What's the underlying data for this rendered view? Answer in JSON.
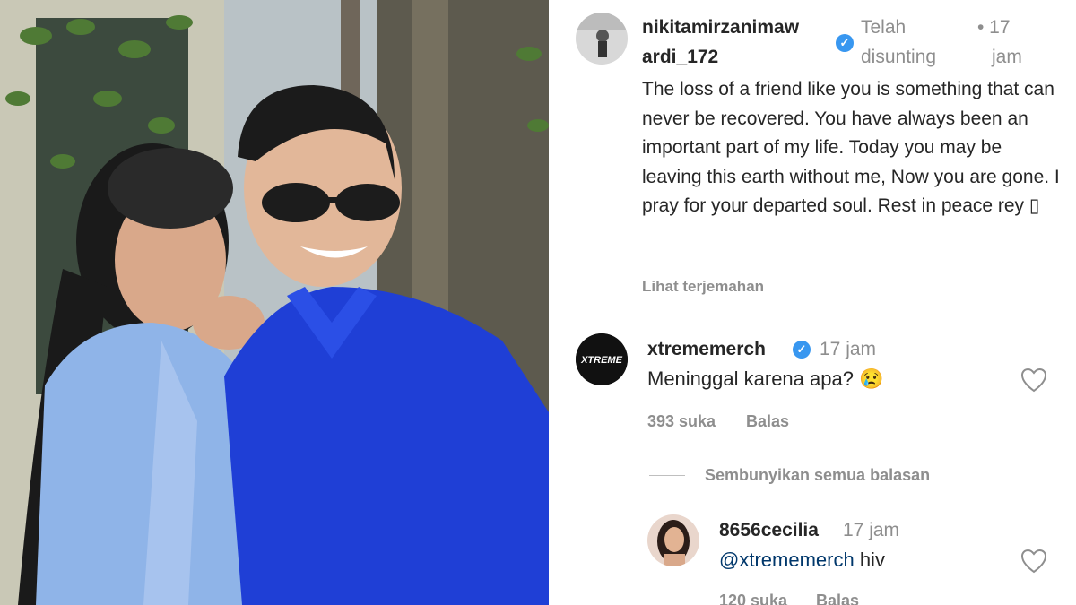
{
  "post": {
    "author": "nikitamirzanimawardi_172",
    "author_line1": "nikitamirzanimaw",
    "author_line2": "ardi_172",
    "edited_line1": "Telah",
    "edited_line2": "disunting",
    "time_line1": "• 17",
    "time_line2": "jam",
    "caption": "The loss of a friend like you is something that can never be recovered. You have always been an important part of my life. Today you may be leaving this earth without me, Now you are gone. I pray for your departed soul. Rest in peace rey ▯",
    "translate_label": "Lihat terjemahan"
  },
  "comments": [
    {
      "username": "xtrememerch",
      "avatar_text": "XTREME",
      "verified": true,
      "time": "17 jam",
      "text": "Meninggal karena apa? 😢",
      "likes": "393 suka",
      "reply_label": "Balas"
    }
  ],
  "thread": {
    "hide_replies_label": "Sembunyikan semua balasan"
  },
  "replies": [
    {
      "username": "8656cecilia",
      "time": "17 jam",
      "mention": "@xtrememerch",
      "text": " hiv",
      "likes": "120 suka",
      "reply_label": "Balas"
    }
  ],
  "icons": {
    "verified": "verified-badge-icon",
    "like": "heart-icon"
  },
  "colors": {
    "verified_blue": "#3897f0",
    "secondary_text": "#8e8e8e",
    "primary_text": "#262626",
    "mention": "#00376b",
    "shirt_blue": "#1f3fd6",
    "blouse_blue": "#8fb4e8"
  }
}
